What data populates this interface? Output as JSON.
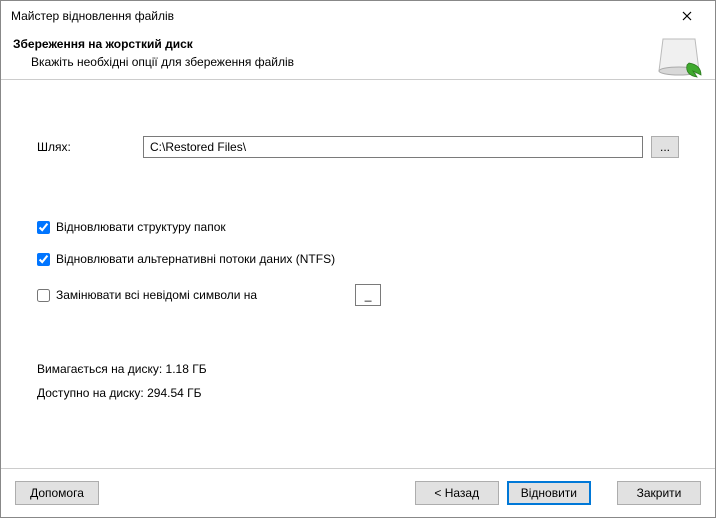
{
  "window": {
    "title": "Майстер відновлення файлів"
  },
  "header": {
    "title": "Збереження на жорсткий диск",
    "subtitle": "Вкажіть необхідні опції для збереження файлів"
  },
  "path": {
    "label": "Шлях:",
    "value": "C:\\Restored Files\\",
    "browse": "..."
  },
  "options": {
    "restore_structure": {
      "label": "Відновлювати структуру папок",
      "checked": true
    },
    "restore_streams": {
      "label": "Відновлювати альтернативні потоки даних (NTFS)",
      "checked": true
    },
    "replace_unknown": {
      "label": "Замінювати всі невідомі символи на",
      "checked": false,
      "value": "_"
    }
  },
  "stats": {
    "required": "Вимагається на диску: 1.18 ГБ",
    "available": "Доступно на диску: 294.54 ГБ"
  },
  "buttons": {
    "help": "Допомога",
    "back": "< Назад",
    "restore": "Відновити",
    "close": "Закрити"
  }
}
